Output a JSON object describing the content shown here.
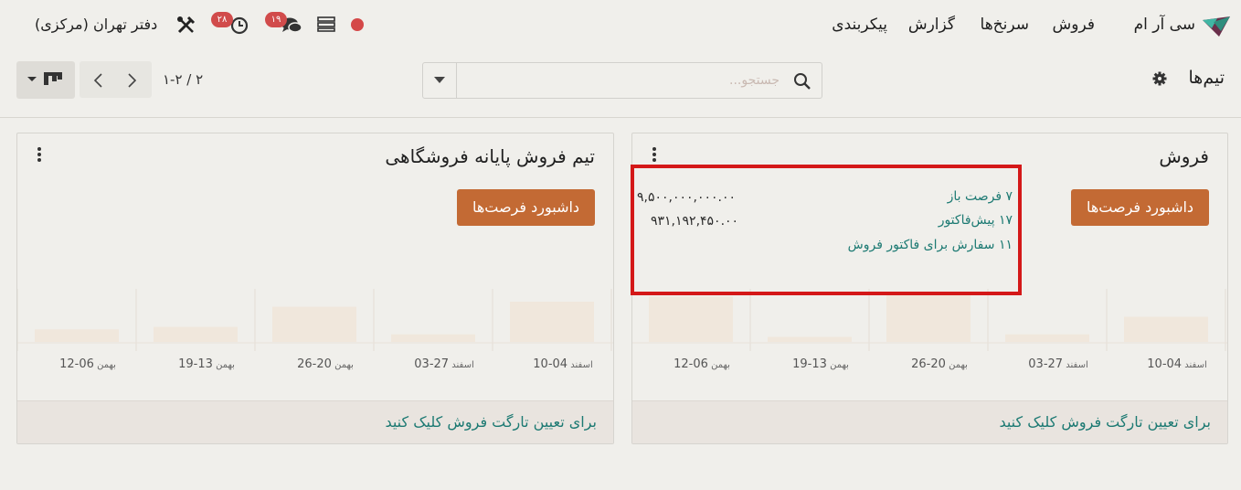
{
  "navbar": {
    "app_name": "سی آر ام",
    "menu": [
      "فروش",
      "سرنخ‌ها",
      "گزارش",
      "پیکربندی"
    ],
    "messages_count": "۱۹",
    "activities_count": "۲۸",
    "company": "دفتر تهران (مرکزی)"
  },
  "controls": {
    "breadcrumb": "تیم‌ها",
    "search_placeholder": "جستجو...",
    "pager": "۱-۲ / ۲"
  },
  "cards": [
    {
      "title": "فروش",
      "dashboard_button": "داشبورد فرصت‌ها",
      "stats": [
        {
          "label": "۷ فرصت باز",
          "value": "۹,۵۰۰,۰۰۰,۰۰۰.۰۰"
        },
        {
          "label": "۱۷ پیش‌فاکتور",
          "value": "۹۳۱,۱۹۲,۴۵۰.۰۰"
        },
        {
          "label": "۱۱ سفارش برای فاکتور فروش",
          "value": ""
        }
      ],
      "footer_link": "برای تعیین تارگت فروش کلیک کنید",
      "chart_data": {
        "type": "bar",
        "categories": [
          "04-10 اسفند",
          "27-03 اسفند",
          "20-26 بهمن",
          "13-19 بهمن",
          "06-12 بهمن"
        ],
        "values": [
          5,
          1.5,
          4712,
          1,
          9
        ],
        "ylim": [
          0,
          10
        ]
      }
    },
    {
      "title": "تیم فروش پایانه فروشگاهی",
      "dashboard_button": "داشبورد فرصت‌ها",
      "stats": [],
      "footer_link": "برای تعیین تارگت فروش کلیک کنید",
      "chart_data": {
        "type": "bar",
        "categories": [
          "04-10 اسفند",
          "27-03 اسفند",
          "20-26 بهمن",
          "13-19 بهمن",
          "06-12 بهمن"
        ],
        "values": [
          8,
          1.5,
          7,
          3,
          2.5
        ],
        "ylim": [
          0,
          10
        ]
      }
    }
  ],
  "colors": {
    "accent": "#c36a34",
    "link": "#1d7a73",
    "badge": "#d14b4b",
    "highlight": "#d41818",
    "bar": "#f0e7dc"
  },
  "icons": [
    "crm-logo-icon",
    "record-dot-icon",
    "list-icon",
    "chat-icon",
    "clock-icon",
    "tools-icon",
    "gear-icon",
    "search-icon",
    "caret-down-icon",
    "chevron-left-icon",
    "chevron-right-icon",
    "kanban-icon",
    "kebab-icon"
  ]
}
